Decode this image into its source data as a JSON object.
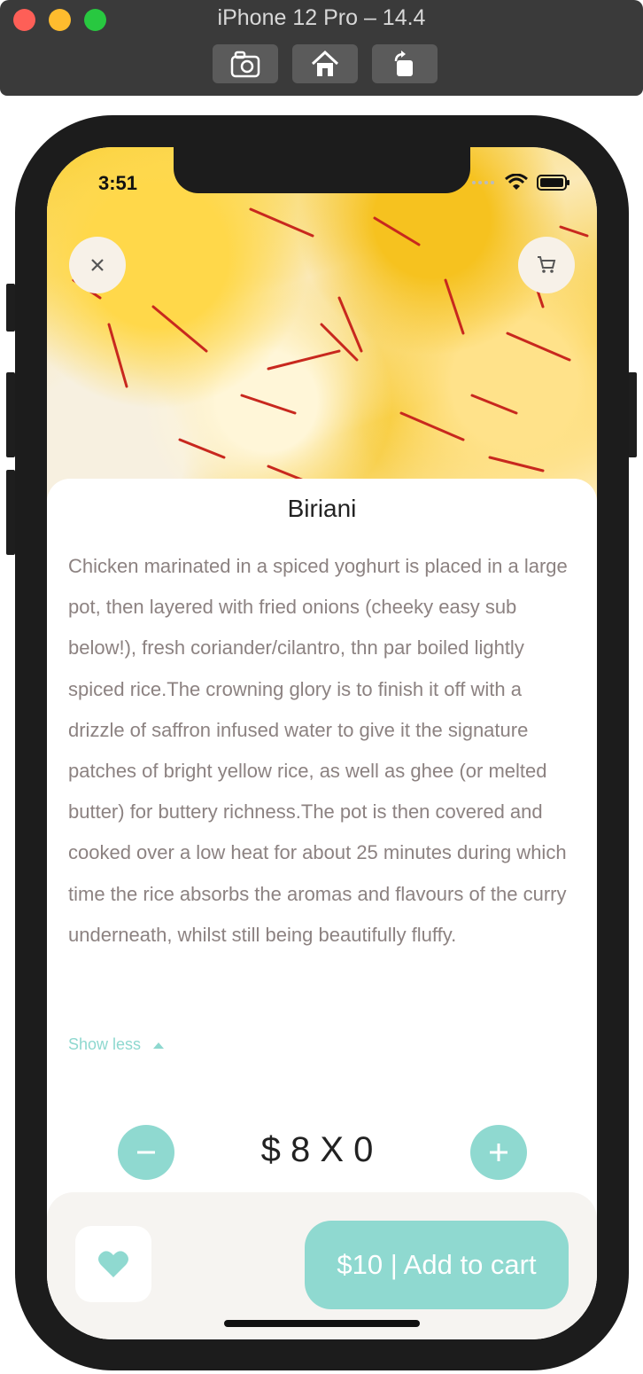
{
  "simulator": {
    "title": "iPhone 12 Pro – 14.4",
    "buttons": [
      "screenshot-icon",
      "home-icon",
      "rotate-icon"
    ]
  },
  "status_bar": {
    "time": "3:51"
  },
  "product": {
    "name": "Biriani",
    "description": "Chicken marinated in a spiced yoghurt is placed in a large pot, then layered with fried onions (cheeky easy sub below!), fresh coriander/cilantro, thn par boiled lightly spiced rice.The crowning glory is to finish it off with a drizzle of saffron infused water to give it the signature patches of bright yellow rice, as well as ghee (or melted butter) for buttery richness.The pot is then covered and cooked over a low heat for about 25 minutes during which time the rice absorbs the aromas and flavours of the curry underneath, whilst still being beautifully fluffy.",
    "show_less_label": "Show less",
    "price_quantity": "$ 8 X 0"
  },
  "actions": {
    "add_to_cart_label": "$10 | Add to cart"
  },
  "colors": {
    "accent": "#8fd9d0",
    "description_text": "#8c8281",
    "bottom_bar": "#f6f4f1"
  }
}
